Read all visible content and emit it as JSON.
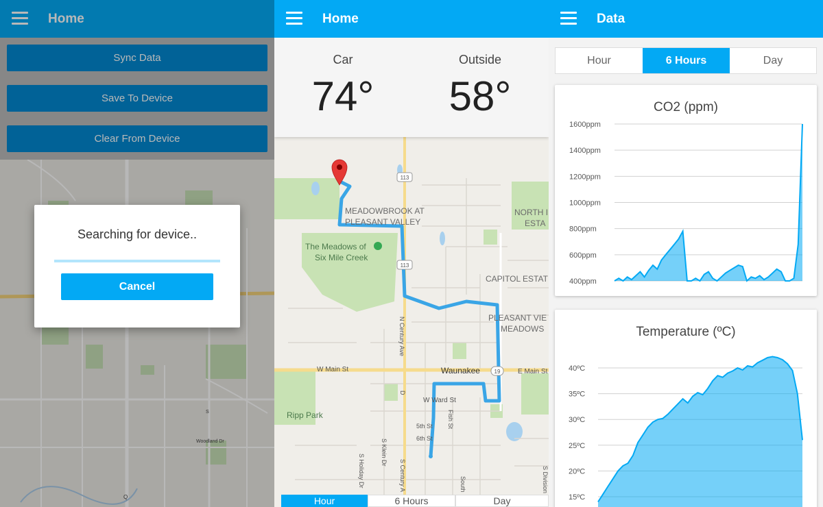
{
  "panel1": {
    "title": "Home",
    "buttons": {
      "sync": "Sync Data",
      "save": "Save To Device",
      "clear": "Clear From Device"
    },
    "dialog": {
      "message": "Searching for device..",
      "cancel": "Cancel"
    },
    "map_labels": {
      "route": "113",
      "woodland": "Woodland Dr",
      "q": "Q",
      "s_st": "S"
    }
  },
  "panel2": {
    "title": "Home",
    "car": {
      "label": "Car",
      "value": "74°"
    },
    "outside": {
      "label": "Outside",
      "value": "58°"
    },
    "map_labels": {
      "meadowbrook1": "MEADOWBROOK AT",
      "meadowbrook2": "PLEASANT VALLEY",
      "meadows1": "The Meadows of",
      "meadows2": "Six Mile Creek",
      "north1": "NORTH I",
      "north2": "ESTA",
      "capitol": "CAPITOL ESTAT",
      "pleasant1": "PLEASANT VIE",
      "pleasant2": "MEADOWS",
      "w_main": "W Main St",
      "waunakee": "Waunakee",
      "e_main": "E Main St",
      "ward": "W Ward St",
      "fifth": "5th St",
      "sixth": "6th St",
      "fish": "Fish St",
      "ripp": "Ripp Park",
      "n_century": "N Century Ave",
      "s_century": "S Century A",
      "s_klein": "S Klein Dr",
      "s_holiday": "S Holiday Dr",
      "s_division": "S Division S",
      "south": "South",
      "d_label": "D",
      "r113a": "113",
      "r113b": "113",
      "r19": "19"
    },
    "tabs": [
      "Hour",
      "6 Hours",
      "Day"
    ]
  },
  "panel3": {
    "title": "Data",
    "tabs": [
      "Hour",
      "6 Hours",
      "Day"
    ],
    "active_tab": "6 Hours",
    "accent": "#03a9f4"
  },
  "chart_data": [
    {
      "type": "area",
      "title": "CO2 (ppm)",
      "y_tick_labels": [
        "1600ppm",
        "1400ppm",
        "1200ppm",
        "1000ppm",
        "800ppm",
        "600ppm",
        "400ppm"
      ],
      "ylim": [
        400,
        1600
      ],
      "y_ticks": [
        400,
        600,
        800,
        1000,
        1200,
        1400,
        1600
      ],
      "grid": true,
      "color": "#03a9f4",
      "values": [
        390,
        420,
        400,
        430,
        410,
        440,
        470,
        430,
        480,
        520,
        490,
        560,
        600,
        640,
        680,
        720,
        780,
        370,
        400,
        420,
        390,
        450,
        470,
        420,
        400,
        430,
        460,
        480,
        500,
        520,
        510,
        400,
        430,
        420,
        440,
        410,
        430,
        460,
        490,
        470,
        400,
        390,
        420,
        680,
        1600
      ]
    },
    {
      "type": "area",
      "title": "Temperature (ºC)",
      "y_tick_labels": [
        "40ºC",
        "35ºC",
        "30ºC",
        "25ºC",
        "20ºC",
        "15ºC"
      ],
      "ylim": [
        13,
        42
      ],
      "y_ticks": [
        15,
        20,
        25,
        30,
        35,
        40
      ],
      "grid": true,
      "color": "#03a9f4",
      "values": [
        14,
        15.5,
        17,
        18.5,
        20,
        21,
        21.5,
        23,
        25.5,
        27,
        28.5,
        29.5,
        30,
        30.2,
        31,
        32,
        33,
        34,
        33.2,
        34.5,
        35.2,
        34.8,
        36,
        37.5,
        38.5,
        38.2,
        39,
        39.4,
        40,
        39.6,
        40.4,
        40.2,
        41,
        41.5,
        42,
        42.2,
        42,
        41.6,
        40.8,
        39.5,
        35,
        26
      ]
    }
  ]
}
